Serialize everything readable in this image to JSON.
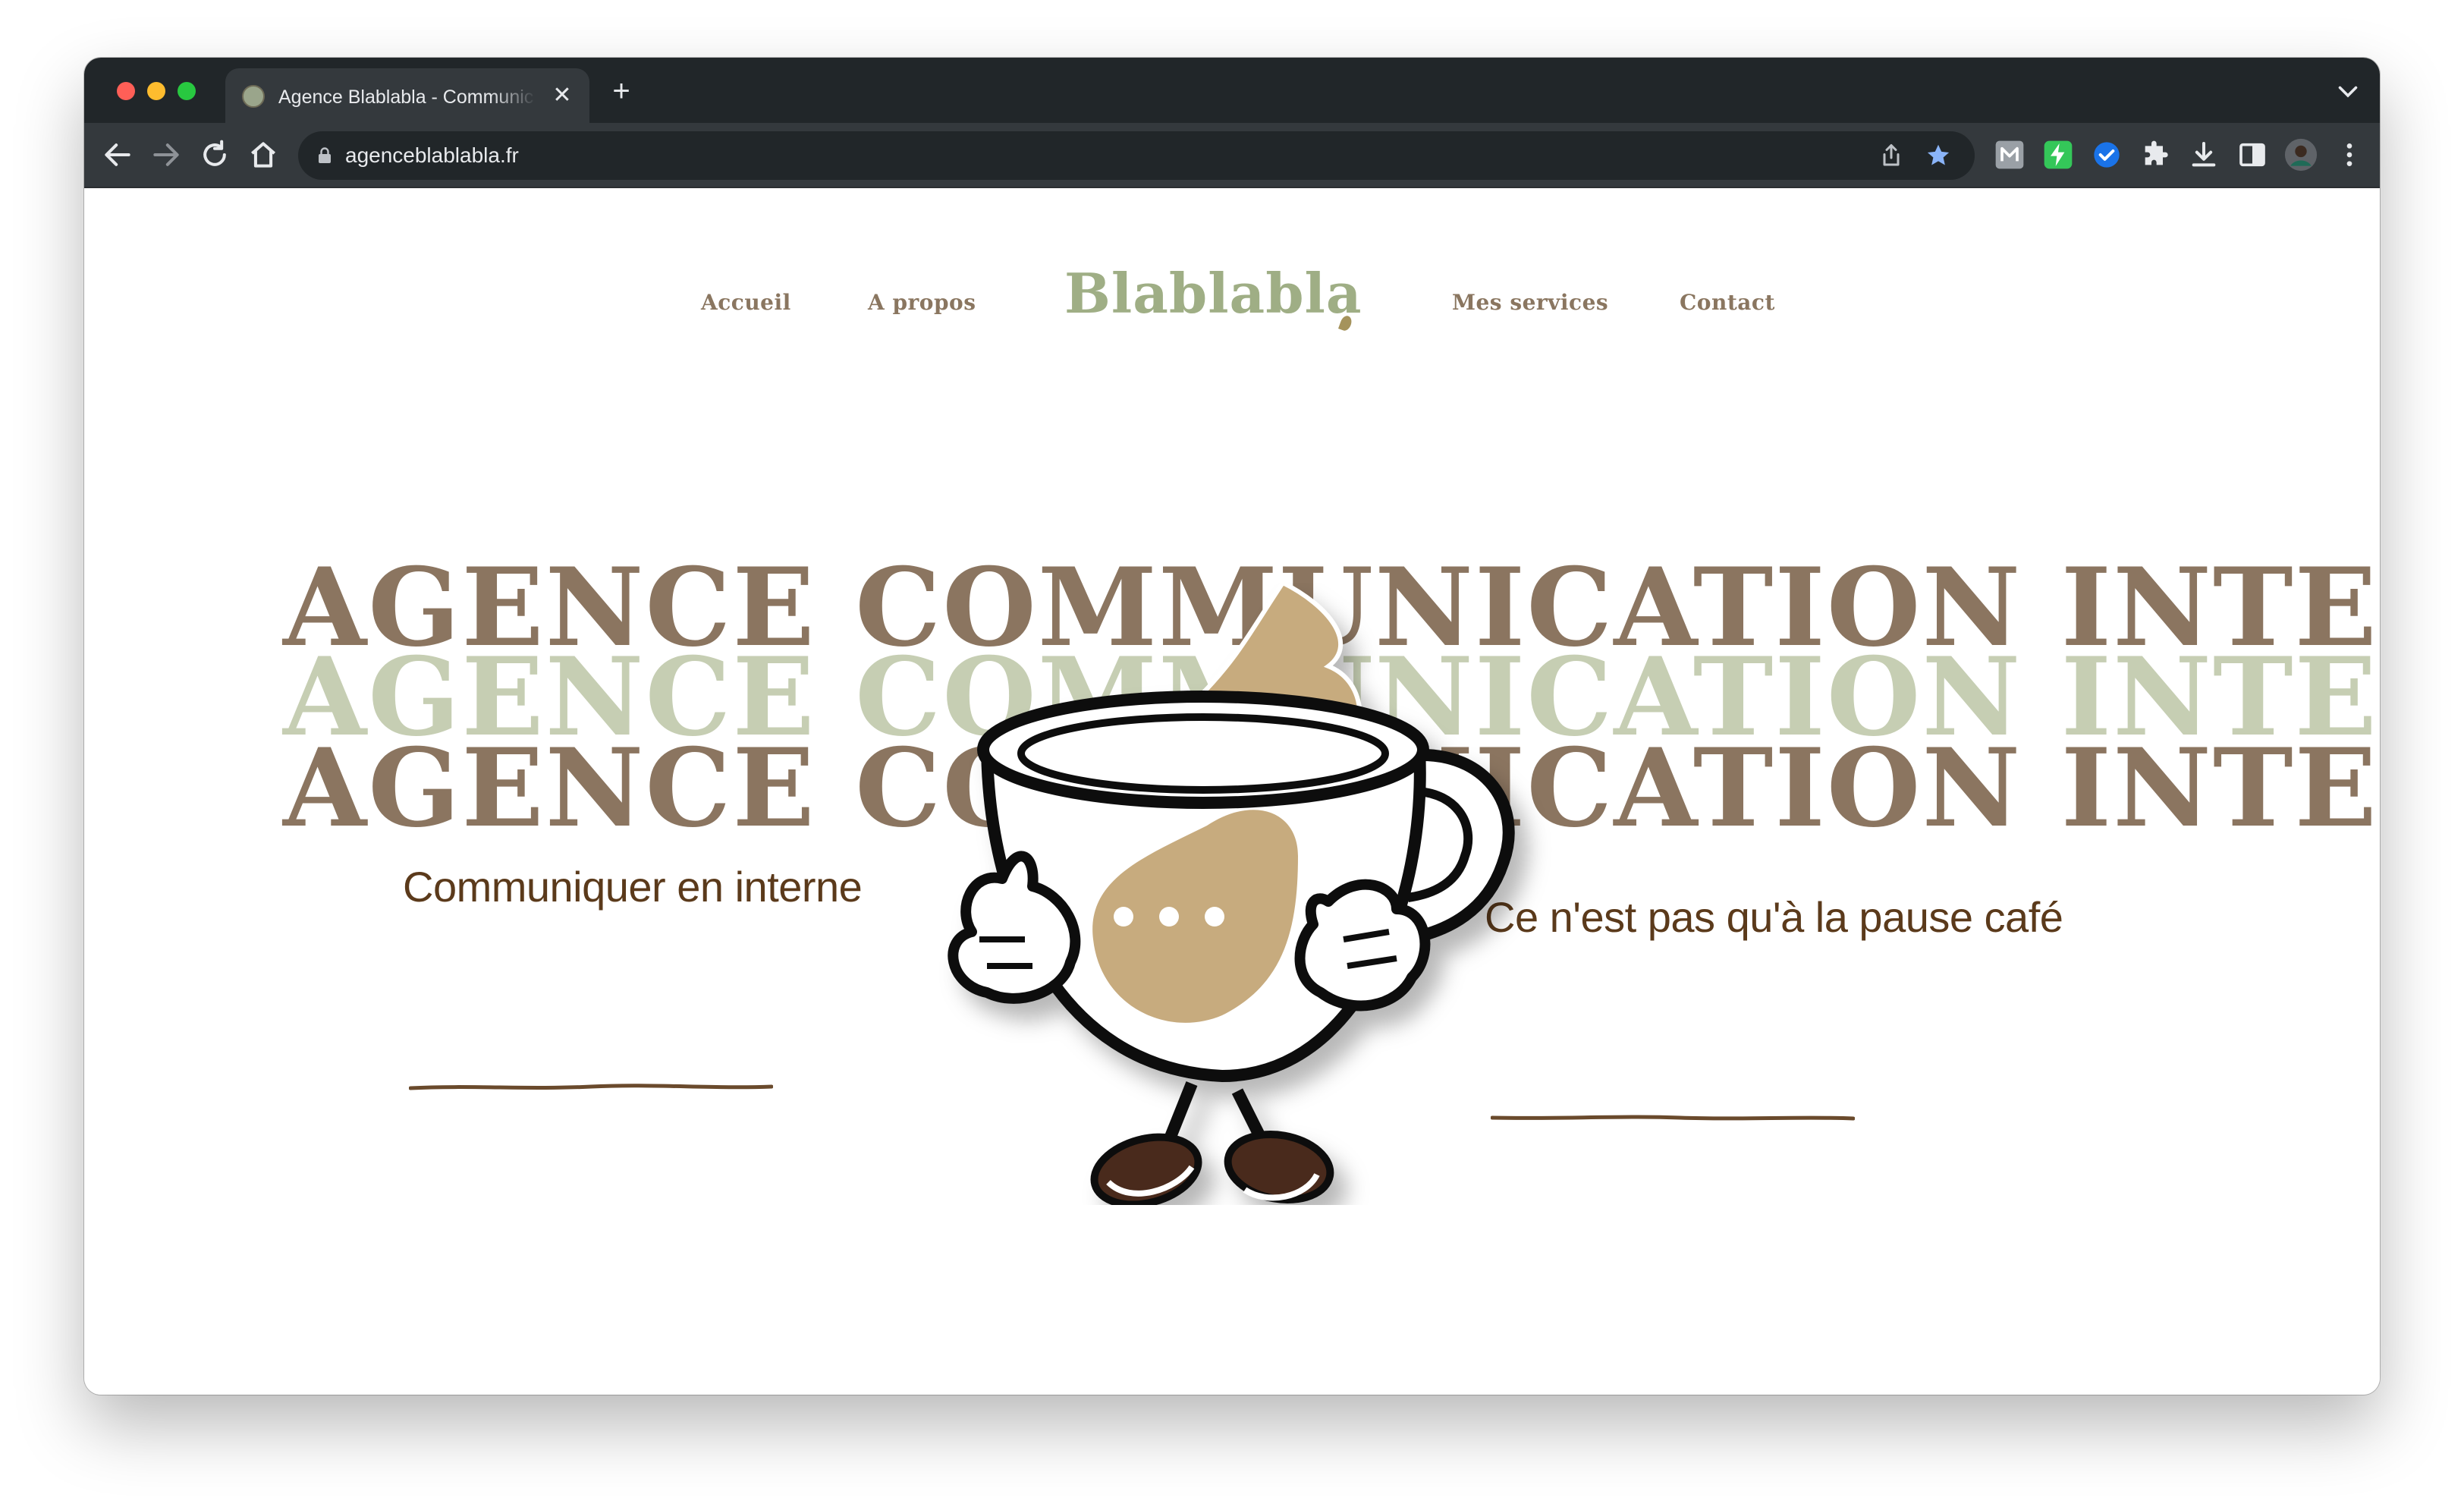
{
  "browser": {
    "tab_title": "Agence Blablabla - Communic",
    "tab_close": "✕",
    "new_tab": "+",
    "url": "agenceblablabla.fr"
  },
  "nav": {
    "items": [
      "Accueil",
      "A propos",
      "Mes services",
      "Contact"
    ],
    "logo": "Blablabla"
  },
  "hero": {
    "headline_1": "AGENCE COMMUNICATION INTERNE",
    "headline_2": "AGENCE COMMUNICATION INTERNE",
    "headline_3": "AGENCE COMMUNICATION INTERNE",
    "left_text": "Communiquer en interne",
    "right_text": "Ce n'est pas qu'à la pause café"
  },
  "colors": {
    "brand_brown": "#8b7560",
    "brand_sage": "#c6ceb3",
    "logo_green": "#9fae85",
    "text_dark_brown": "#5b3a1b",
    "coffee_tan": "#c7ab7e"
  },
  "icons": [
    "back-icon",
    "forward-icon",
    "reload-icon",
    "home-icon",
    "lock-icon",
    "share-icon",
    "bookmark-star-icon",
    "extension-icon",
    "download-icon",
    "sidepanel-icon",
    "profile-avatar",
    "menu-icon"
  ]
}
